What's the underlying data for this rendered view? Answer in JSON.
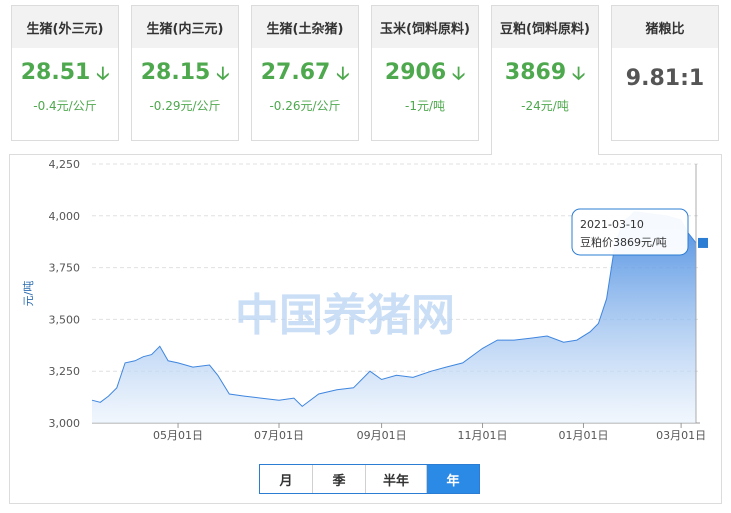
{
  "cards": [
    {
      "title": "生猪(外三元)",
      "price": "28.51",
      "change": "-0.4元/公斤",
      "direction": "down"
    },
    {
      "title": "生猪(内三元)",
      "price": "28.15",
      "change": "-0.29元/公斤",
      "direction": "down"
    },
    {
      "title": "生猪(土杂猪)",
      "price": "27.67",
      "change": "-0.26元/公斤",
      "direction": "down"
    },
    {
      "title": "玉米(饲料原料)",
      "price": "2906",
      "change": "-1元/吨",
      "direction": "down"
    },
    {
      "title": "豆粕(饲料原料)",
      "price": "3869",
      "change": "-24元/吨",
      "direction": "down"
    }
  ],
  "ratio_card": {
    "title": "猪粮比",
    "value": "9.81:1"
  },
  "icons": {
    "down_arrow": "down-arrow-icon"
  },
  "colors": {
    "down": "#4ea84e",
    "accent": "#2b8ae6",
    "area_top": "#3f86df",
    "area_bottom": "#e8f1fc"
  },
  "watermark": "中国养猪网",
  "tabs": [
    {
      "label": "月",
      "active": false
    },
    {
      "label": "季",
      "active": false
    },
    {
      "label": "半年",
      "active": false
    },
    {
      "label": "年",
      "active": true
    }
  ],
  "chart_data": {
    "type": "area",
    "ylabel": "元/吨",
    "ylim": [
      3000,
      4250
    ],
    "yticks": [
      3000,
      3250,
      3500,
      3750,
      4000,
      4250
    ],
    "ytick_labels": [
      "3,000",
      "3,250",
      "3,500",
      "3,750",
      "4,000",
      "4,250"
    ],
    "xlim": [
      "2020-03-10",
      "2021-03-10"
    ],
    "xticks": [
      "2020-05-01",
      "2020-07-01",
      "2020-09-01",
      "2020-11-01",
      "2021-01-01",
      "2021-03-01"
    ],
    "xtick_labels": [
      "05月01日",
      "07月01日",
      "09月01日",
      "11月01日",
      "01月01日",
      "03月01日"
    ],
    "grid": true,
    "series": [
      {
        "values_x": [
          "2020-03-10",
          "2020-03-15",
          "2020-03-20",
          "2020-03-25",
          "2020-03-30",
          "2020-04-05",
          "2020-04-10",
          "2020-04-15",
          "2020-04-20",
          "2020-04-25",
          "2020-05-01",
          "2020-05-10",
          "2020-05-20",
          "2020-05-25",
          "2020-06-01",
          "2020-06-10",
          "2020-06-20",
          "2020-07-01",
          "2020-07-10",
          "2020-07-15",
          "2020-07-25",
          "2020-08-05",
          "2020-08-15",
          "2020-08-25",
          "2020-09-01",
          "2020-09-10",
          "2020-09-20",
          "2020-10-01",
          "2020-10-10",
          "2020-10-20",
          "2020-11-01",
          "2020-11-10",
          "2020-11-20",
          "2020-12-01",
          "2020-12-10",
          "2020-12-20",
          "2020-12-28",
          "2021-01-05",
          "2021-01-10",
          "2021-01-15",
          "2021-01-20",
          "2021-01-25",
          "2021-02-01",
          "2021-02-10",
          "2021-02-20",
          "2021-03-01",
          "2021-03-05",
          "2021-03-10"
        ],
        "values_y": [
          3110,
          3100,
          3130,
          3170,
          3290,
          3300,
          3320,
          3330,
          3370,
          3300,
          3290,
          3270,
          3280,
          3230,
          3140,
          3130,
          3120,
          3110,
          3120,
          3080,
          3140,
          3160,
          3170,
          3250,
          3210,
          3230,
          3220,
          3250,
          3270,
          3290,
          3360,
          3400,
          3400,
          3410,
          3420,
          3390,
          3400,
          3440,
          3480,
          3600,
          3860,
          3970,
          4020,
          4010,
          4000,
          3980,
          3920,
          3869
        ]
      }
    ],
    "tooltip": {
      "date": "2021-03-10",
      "text": "豆粕价3869元/吨"
    }
  }
}
